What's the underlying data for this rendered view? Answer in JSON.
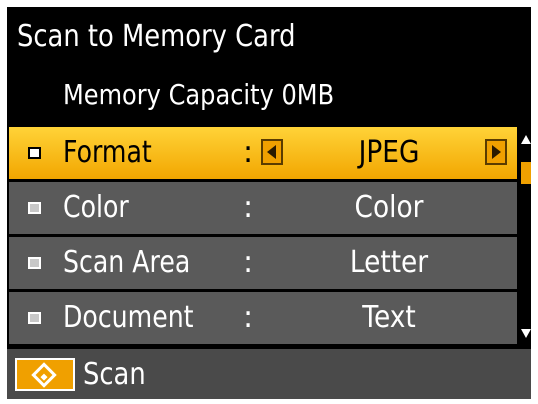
{
  "screen": {
    "title": "Scan to Memory Card",
    "capacity": "Memory Capacity 0MB"
  },
  "menu": {
    "items": [
      {
        "label": "Format",
        "colon": ":",
        "value": "JPEG",
        "selected": true
      },
      {
        "label": "Color",
        "colon": ":",
        "value": "Color",
        "selected": false
      },
      {
        "label": "Scan Area",
        "colon": ":",
        "value": "Letter",
        "selected": false
      },
      {
        "label": "Document",
        "colon": ":",
        "value": "Text",
        "selected": false
      }
    ]
  },
  "footer": {
    "start_icon": "start-diamond-icon",
    "label": "Scan"
  },
  "colors": {
    "background": "#000000",
    "row": "#5a5a5a",
    "selected": "#f7be1c",
    "accent": "#f0a000",
    "footer": "#4a4a4a"
  }
}
